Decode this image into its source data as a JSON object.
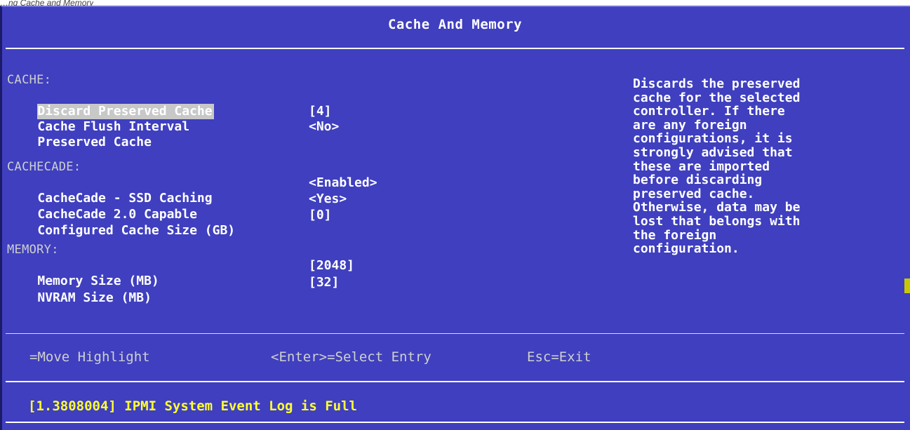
{
  "caption": "…ng Cache and Memory",
  "window": {
    "title": "Cache And Memory"
  },
  "sections": {
    "cache": {
      "heading": "CACHE:",
      "items": [
        {
          "label": "Discard Preserved Cache",
          "value": ""
        },
        {
          "label": "Cache Flush Interval",
          "value": "[4]"
        },
        {
          "label": "Preserved Cache",
          "value": "<No>"
        }
      ]
    },
    "cachecade": {
      "heading": "CACHECADE:",
      "items": [
        {
          "label": "CacheCade - SSD Caching",
          "value": "<Enabled>"
        },
        {
          "label": "CacheCade 2.0 Capable",
          "value": "<Yes>"
        },
        {
          "label": "Configured Cache Size (GB)",
          "value": "[0]"
        }
      ]
    },
    "memory": {
      "heading": "MEMORY:",
      "items": [
        {
          "label": "Memory Size (MB)",
          "value": "[2048]"
        },
        {
          "label": "NVRAM Size (MB)",
          "value": "[32]"
        }
      ]
    }
  },
  "help": {
    "lines": [
      "Discards the preserved",
      "cache for the selected",
      "controller. If there",
      "are any foreign",
      "configurations, it is",
      "strongly advised that",
      "these are imported",
      "before discarding",
      "preserved cache.",
      "Otherwise, data may be",
      "lost that belongs with",
      "the foreign",
      "configuration."
    ]
  },
  "keys": {
    "move": "=Move Highlight",
    "select": "<Enter>=Select Entry",
    "exit": "Esc=Exit"
  },
  "status": {
    "message": "[1.3808004] IPMI System Event Log is Full"
  },
  "colors": {
    "background": "#3f3fbf",
    "highlight": "#c8c8c8",
    "status_text": "#ffff33"
  }
}
